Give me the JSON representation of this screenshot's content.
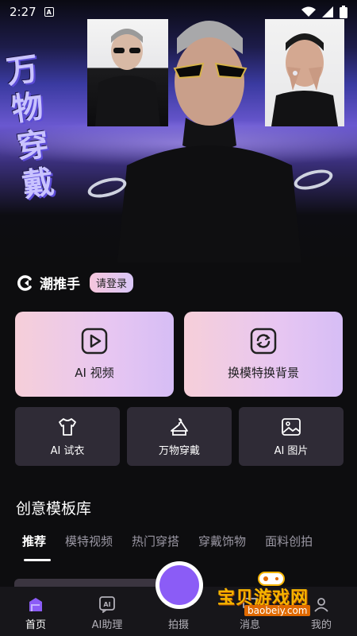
{
  "status_bar": {
    "time": "2:27",
    "app_badge": "A"
  },
  "hero": {
    "title_chars": [
      "万",
      "物",
      "穿",
      "戴"
    ]
  },
  "brand": {
    "name": "潮推手",
    "login_label": "请登录"
  },
  "feature_cards": [
    {
      "label": "AI 视频",
      "icon": "play-icon"
    },
    {
      "label": "换模特换背景",
      "icon": "refresh-icon"
    }
  ],
  "tool_cards": [
    {
      "label": "AI 试衣",
      "icon": "tshirt-icon"
    },
    {
      "label": "万物穿戴",
      "icon": "hanger-icon"
    },
    {
      "label": "AI 图片",
      "icon": "image-icon"
    }
  ],
  "section": {
    "title": "创意模板库",
    "tabs": [
      "推荐",
      "模特视频",
      "热门穿搭",
      "穿戴饰物",
      "面料创拍"
    ],
    "active_tab": "推荐"
  },
  "bottom_nav": {
    "items": [
      {
        "label": "首页",
        "icon": "home-icon"
      },
      {
        "label": "AI助理",
        "icon": "ai-assistant-icon"
      },
      {
        "label": "拍摄",
        "icon": "capture-icon"
      },
      {
        "label": "消息",
        "icon": "message-icon"
      },
      {
        "label": "我的",
        "icon": "profile-icon"
      }
    ],
    "active": "首页"
  },
  "watermark": {
    "text": "宝贝游戏网",
    "url": "baobeiy.com"
  },
  "colors": {
    "accent": "#8b5cf6",
    "card_pink": "#f6cfd9",
    "card_lilac": "#d6bdf5",
    "tool_card_bg": "#2f2b36"
  }
}
